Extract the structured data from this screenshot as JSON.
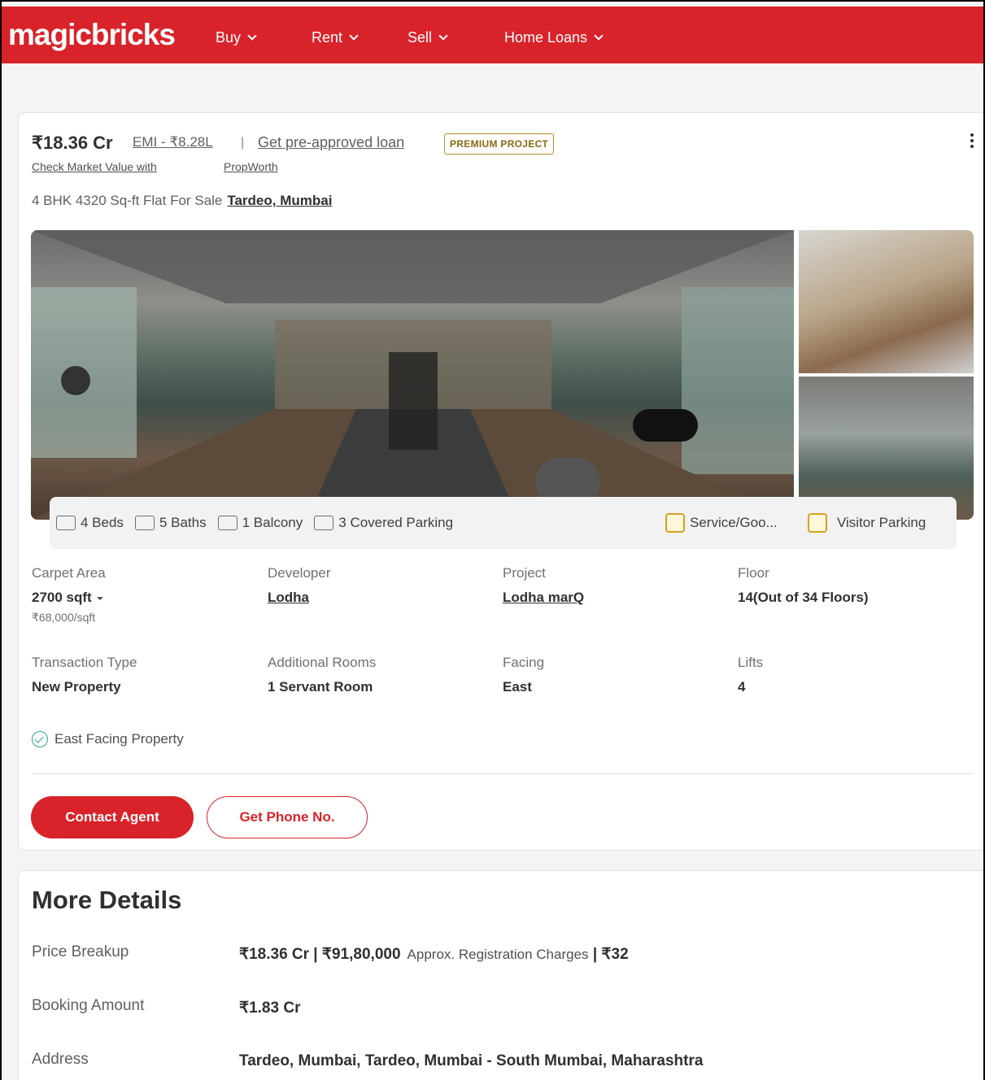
{
  "header": {
    "logo": "magicbricks",
    "nav": [
      {
        "label": "Buy"
      },
      {
        "label": "Rent"
      },
      {
        "label": "Sell"
      },
      {
        "label": "Home Loans"
      }
    ]
  },
  "listing": {
    "price": "₹18.36 Cr",
    "emi": "EMI - ₹8.28L",
    "separator": "|",
    "loan_link": "Get pre-approved loan",
    "badge": "PREMIUM PROJECT",
    "market_value_link": "Check Market Value with",
    "propworth_link": "PropWorth",
    "subtitle": "4 BHK 4320 Sq-ft Flat For Sale",
    "location_link": "Tardeo, Mumbai",
    "amenities": [
      {
        "label": "4 Beds",
        "icon": "bed-icon"
      },
      {
        "label": "5 Baths",
        "icon": "bath-icon"
      },
      {
        "label": "1 Balcony",
        "icon": "balcony-icon"
      },
      {
        "label": "3 Covered Parking",
        "icon": "car-icon"
      },
      {
        "label": "Service/Goo...",
        "icon": "service-lift-icon"
      },
      {
        "label": "Visitor Parking",
        "icon": "visitor-parking-icon"
      }
    ],
    "details": {
      "carpet_area": {
        "label": "Carpet Area",
        "value": "2700 sqft",
        "sub": "₹68,000/sqft"
      },
      "developer": {
        "label": "Developer",
        "value": "Lodha"
      },
      "project": {
        "label": "Project",
        "value": "Lodha marQ"
      },
      "floor": {
        "label": "Floor",
        "value": "14(Out of 34 Floors)"
      },
      "transaction": {
        "label": "Transaction Type",
        "value": "New Property"
      },
      "additional_rooms": {
        "label": "Additional Rooms",
        "value": "1 Servant Room"
      },
      "facing": {
        "label": "Facing",
        "value": "East"
      },
      "lifts": {
        "label": "Lifts",
        "value": "4"
      }
    },
    "facing_note": "East Facing Property",
    "contact_button": "Contact Agent",
    "phone_button": "Get Phone No."
  },
  "more_details": {
    "title": "More Details",
    "rows": [
      {
        "label": "Price Breakup",
        "value": "₹18.36 Cr | ₹91,80,000",
        "extra": "Approx. Registration Charges",
        "extra_value": "| ₹32"
      },
      {
        "label": "Booking Amount",
        "value": "₹1.83 Cr"
      },
      {
        "label": "Address",
        "value": "Tardeo, Mumbai, Tardeo, Mumbai - South Mumbai, Maharashtra"
      }
    ]
  },
  "colors": {
    "brand": "#d8232a",
    "premium": "#b58b1e",
    "check": "#2da58a"
  }
}
